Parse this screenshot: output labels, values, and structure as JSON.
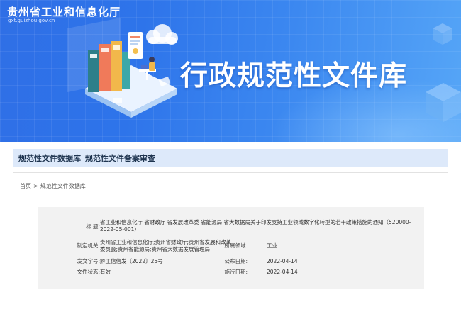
{
  "header": {
    "site_name": "贵州省工业和信息化厅",
    "site_domain": "gxt.guizhou.gov.cn",
    "banner_title": "行政规范性文件库",
    "colors": {
      "banner_start": "#2f6fe6",
      "banner_end": "#56a6f7"
    }
  },
  "nav": {
    "items": [
      {
        "label": "规范性文件数据库"
      },
      {
        "label": "规范性文件备案审查"
      }
    ]
  },
  "breadcrumb": {
    "home": "首页",
    "separator": ">",
    "current": "规范性文件数据库"
  },
  "document": {
    "title_label": "标 题:",
    "title_value": "省工业和信息化厅 省财政厅 省发展改革委 省能源局 省大数据局关于印发支持工业领域数字化转型的若干政策措施的通知（520000-2022-05-001）",
    "issuer_label": "制定机关:",
    "issuer_value": "贵州省工业和信息化厅;贵州省财政厅;贵州省发展和改革委员会;贵州省能源局;贵州省大数据发展管理局",
    "field_label": "所属领域:",
    "field_value": "工业",
    "doc_no_label": "发文字号:",
    "doc_no_value": "黔工信信发〔2022〕25号",
    "publish_label": "公布日期:",
    "publish_value": "2022-04-14",
    "status_label": "文件状态:",
    "status_value": "有效",
    "effective_label": "施行日期:",
    "effective_value": "2022-04-14"
  }
}
